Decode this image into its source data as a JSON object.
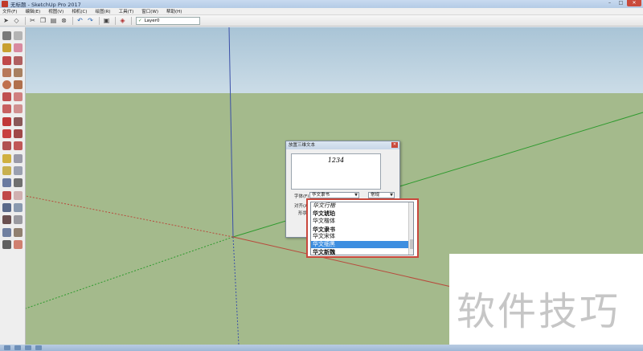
{
  "window": {
    "title": "无标题 - SketchUp Pro 2017",
    "controls": [
      "–",
      "□",
      "✕"
    ]
  },
  "menubar": {
    "items": [
      "文件(F)",
      "编辑(E)",
      "视图(V)",
      "相机(C)",
      "绘图(R)",
      "工具(T)",
      "窗口(W)",
      "帮助(H)"
    ]
  },
  "toolbar": {
    "layer_name": "Layer0",
    "layer_check": "✓"
  },
  "dialog": {
    "title": "放置三维文本",
    "close_label": "✕",
    "text_value": "1234",
    "font_label": "字体(F)",
    "align_label": "对齐(A)",
    "shape_label": "形状",
    "font_value": "华文隶书",
    "style_value": "常规"
  },
  "font_dropdown": {
    "items": [
      "华文行楷",
      "华文琥珀",
      "华文楷体",
      "华文隶书",
      "华文宋体",
      "华文细黑",
      "华文新魏"
    ],
    "selected_index": 5
  },
  "watermark": {
    "text": "软件技巧"
  },
  "colors": {
    "sky": "#b9d0de",
    "ground": "#a4ba8c",
    "axis_blue": "#3a4fa8",
    "axis_green": "#2e9a2e",
    "axis_red": "#b84a3c",
    "highlight": "#3d8ee0",
    "dropdown_border": "#c9473c"
  }
}
